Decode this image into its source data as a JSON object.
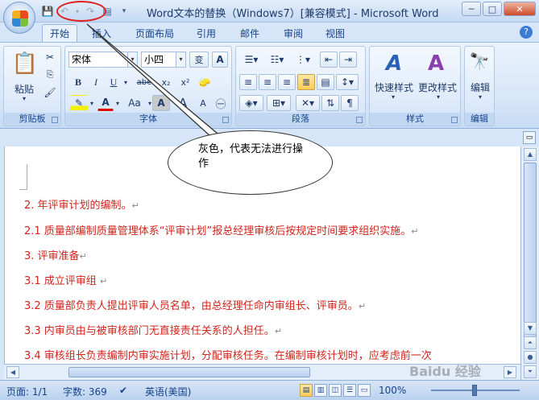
{
  "window": {
    "title": "Word文本的替换（Windows7）[兼容模式] - Microsoft Word",
    "controls": [
      "─",
      "□",
      "✕"
    ]
  },
  "qat": {
    "save_icon": "💾",
    "undo_icon": "↶",
    "redo_icon": "↷",
    "print_icon": "▤",
    "more_icon": "▾"
  },
  "tabs": [
    "开始",
    "插入",
    "页面布局",
    "引用",
    "邮件",
    "审阅",
    "视图"
  ],
  "help": "?",
  "ribbon": {
    "clipboard": {
      "label": "剪贴板",
      "paste": "粘贴"
    },
    "font": {
      "label": "字体",
      "font_name": "宋体",
      "font_size": "小四",
      "bold": "B",
      "italic": "I",
      "underline": "U",
      "strike": "abe",
      "subscript": "x₂",
      "superscript": "x²",
      "grow": "A",
      "shrink": "A",
      "change_case": "Aa",
      "wen": "变",
      "char_border": "A"
    },
    "paragraph": {
      "label": "段落"
    },
    "styles": {
      "label": "样式",
      "quick_styles": "快速样式",
      "change_styles": "更改样式"
    },
    "editing": {
      "label": "编辑",
      "editing_btn": "编辑"
    }
  },
  "callout": {
    "text": "灰色，代表无法进行操作"
  },
  "document": {
    "paragraphs": [
      "2. 年评审计划的编制。",
      "2.1 质量部编制质量管理体系“评审计划”报总经理审核后按规定时间要求组织实施。",
      "3.  评审准备",
      "3.1 成立评审组 ",
      "3.2 质量部负责人提出评审人员名单，由总经理任命内审组长、评审员。",
      "3.3 内审员由与被审核部门无直接责任关系的人担任。",
      "3.4 审核组长负责编制内审实施计划，分配审核任务。在编制审核计划时，应考虑前一次"
    ],
    "para_mark": "↵"
  },
  "status": {
    "page": "页面: 1/1",
    "words": "字数: 369",
    "language": "英语(美国)",
    "zoom": "100%"
  },
  "watermark": "Baidu 经验",
  "colors": {
    "text_red": "#d0251c",
    "highlight_ellipse": "#e02020"
  }
}
